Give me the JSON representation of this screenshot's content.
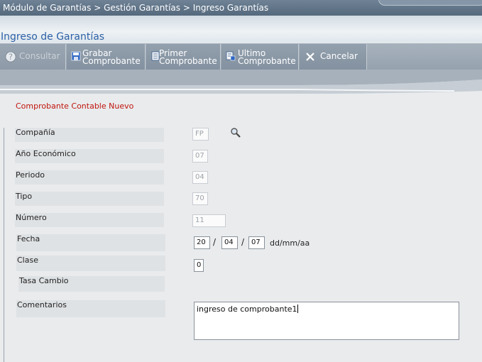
{
  "breadcrumb": "Módulo de Garantías > Gestión Garantías > Ingreso Garantías",
  "page_title": "Ingreso de Garantías",
  "toolbar": {
    "consultar": "Consultar",
    "grabar_1": "Grabar",
    "grabar_2": "Comprobante",
    "primer_1": "Primer",
    "primer_2": "Comprobante",
    "ultimo_1": "Ultimo",
    "ultimo_2": "Comprobante",
    "cancelar": "Cancelar"
  },
  "form": {
    "heading": "Comprobante Contable Nuevo",
    "compania_label": "Compañía",
    "compania_value": "FP",
    "anio_label": "Año Económico",
    "anio_value": "07",
    "periodo_label": "Periodo",
    "periodo_value": "04",
    "tipo_label": "Tipo",
    "tipo_value": "70",
    "numero_label": "Número",
    "numero_value": "11",
    "fecha_label": "Fecha",
    "fecha_dd": "20",
    "fecha_mm": "04",
    "fecha_aa": "07",
    "fecha_sep": "/",
    "fecha_format": "dd/mm/aa",
    "clase_label": "Clase",
    "clase_value": "0",
    "tasa_label": "Tasa Cambio",
    "comentarios_label": "Comentarios",
    "comentarios_value": "ingreso de comprobante1"
  }
}
